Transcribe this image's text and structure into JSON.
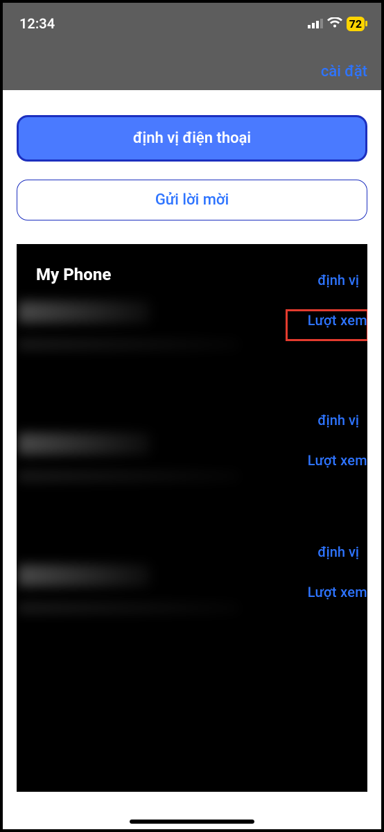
{
  "statusBar": {
    "time": "12:34",
    "battery": "72"
  },
  "nav": {
    "settings": "cài đặt"
  },
  "buttons": {
    "locate": "định vị điện thoại",
    "invite": "Gửi lời mời"
  },
  "panel": {
    "title": "My Phone",
    "rows": [
      {
        "locateLabel": "định vị",
        "viewLabel": "Lượt xem"
      },
      {
        "locateLabel": "định vị",
        "viewLabel": "Lượt xem"
      },
      {
        "locateLabel": "định vị",
        "viewLabel": "Lượt xem"
      }
    ]
  }
}
